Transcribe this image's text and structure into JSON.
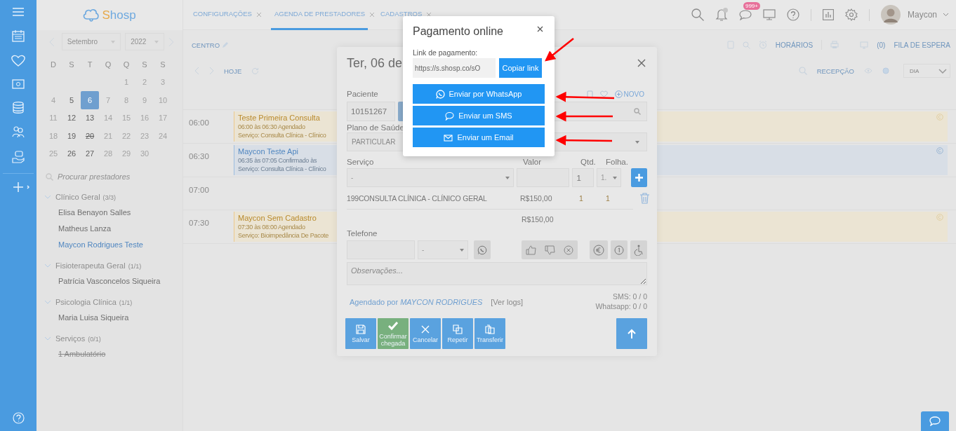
{
  "logo": {
    "text": "Shosp"
  },
  "date_picker": {
    "month": "Setembro",
    "year": "2022",
    "weekdays": [
      "D",
      "S",
      "T",
      "Q",
      "Q",
      "S",
      "S"
    ],
    "days": [
      {
        "label": "1",
        "available": false,
        "selected": false,
        "struck": false
      },
      {
        "label": "2",
        "available": false,
        "selected": false,
        "struck": false
      },
      {
        "label": "3",
        "available": false,
        "selected": false,
        "struck": false
      },
      {
        "label": "4",
        "available": false,
        "selected": false,
        "struck": false
      },
      {
        "label": "5",
        "available": true,
        "selected": false,
        "struck": false
      },
      {
        "label": "6",
        "available": true,
        "selected": true,
        "struck": false
      },
      {
        "label": "7",
        "available": false,
        "selected": false,
        "struck": false
      },
      {
        "label": "8",
        "available": false,
        "selected": false,
        "struck": false
      },
      {
        "label": "9",
        "available": false,
        "selected": false,
        "struck": false
      },
      {
        "label": "10",
        "available": false,
        "selected": false,
        "struck": false
      },
      {
        "label": "11",
        "available": false,
        "selected": false,
        "struck": false
      },
      {
        "label": "12",
        "available": true,
        "selected": false,
        "struck": false
      },
      {
        "label": "13",
        "available": true,
        "selected": false,
        "struck": false
      },
      {
        "label": "14",
        "available": false,
        "selected": false,
        "struck": false
      },
      {
        "label": "15",
        "available": false,
        "selected": false,
        "struck": false
      },
      {
        "label": "16",
        "available": false,
        "selected": false,
        "struck": false
      },
      {
        "label": "17",
        "available": false,
        "selected": false,
        "struck": false
      },
      {
        "label": "18",
        "available": false,
        "selected": false,
        "struck": false
      },
      {
        "label": "19",
        "available": true,
        "selected": false,
        "struck": false
      },
      {
        "label": "20",
        "available": true,
        "selected": false,
        "struck": true
      },
      {
        "label": "21",
        "available": false,
        "selected": false,
        "struck": false
      },
      {
        "label": "22",
        "available": false,
        "selected": false,
        "struck": false
      },
      {
        "label": "23",
        "available": false,
        "selected": false,
        "struck": false
      },
      {
        "label": "24",
        "available": false,
        "selected": false,
        "struck": false
      },
      {
        "label": "25",
        "available": false,
        "selected": false,
        "struck": false
      },
      {
        "label": "26",
        "available": true,
        "selected": false,
        "struck": false
      },
      {
        "label": "27",
        "available": true,
        "selected": false,
        "struck": false
      },
      {
        "label": "28",
        "available": false,
        "selected": false,
        "struck": false
      },
      {
        "label": "29",
        "available": false,
        "selected": false,
        "struck": false
      },
      {
        "label": "30",
        "available": false,
        "selected": false,
        "struck": false
      }
    ]
  },
  "provider_search": {
    "placeholder": "Procurar prestadores"
  },
  "provider_groups": [
    {
      "name": "Clínico Geral",
      "count": "(3/3)",
      "expanded": true,
      "children": [
        {
          "name": "Elisa Benayon Salles",
          "selected": false,
          "inactive": false
        },
        {
          "name": "Matheus Lanza",
          "selected": false,
          "inactive": false
        },
        {
          "name": "Maycon Rodrigues Teste",
          "selected": true,
          "inactive": false
        }
      ]
    },
    {
      "name": "Fisioterapeuta Geral",
      "count": "(1/1)",
      "expanded": true,
      "children": [
        {
          "name": "Patrícia Vasconcelos Siqueira",
          "selected": false,
          "inactive": false
        }
      ]
    },
    {
      "name": "Psicologia Clínica",
      "count": "(1/1)",
      "expanded": true,
      "children": [
        {
          "name": "Maria Luisa Siqueira",
          "selected": false,
          "inactive": false
        }
      ]
    },
    {
      "name": "Serviços",
      "count": "(0/1)",
      "expanded": true,
      "children": [
        {
          "name": "1 Ambulatório",
          "selected": false,
          "inactive": true
        }
      ]
    }
  ],
  "tabs": [
    {
      "label": "CONFIGURAÇÕES",
      "selected": false
    },
    {
      "label": "AGENDA DE PRESTADORES",
      "selected": true
    },
    {
      "label": "CADASTROS",
      "selected": false
    }
  ],
  "header": {
    "messages_badge": "999+",
    "user_name": "Maycon"
  },
  "toolbar": {
    "location": "CENTRO",
    "schedule_label": "HORÁRIOS",
    "queue_count": "(0)",
    "queue_label": "FILA DE ESPERA",
    "today": "HOJE",
    "reception": "RECEPÇÃO",
    "view": "DIA"
  },
  "schedule": [
    {
      "time": "06:00",
      "events": [
        {
          "kind": "scheduled",
          "title": "Teste Primeira Consulta",
          "detail": "06:00 às 06:30 Agendado",
          "service": "Serviço: Consulta Clínica - Clínico"
        }
      ]
    },
    {
      "time": "06:30",
      "events": [
        {
          "kind": "confirmed",
          "title": "Maycon Teste Api",
          "detail": "06:35 às 07:05 Confirmado às",
          "service": "Serviço: Consulta Clínica - Clínico"
        }
      ]
    },
    {
      "time": "07:00"
    },
    {
      "time": "07:30",
      "events": [
        {
          "kind": "scheduled",
          "title": "Maycon Sem Cadastro",
          "detail": "07:30 às 08:00 Agendado",
          "service": "Serviço: Bioimpedância De Pacote"
        }
      ]
    }
  ],
  "appointment": {
    "title": "Ter, 06 de",
    "patient_label": "Paciente",
    "new_label": "NOVO",
    "patient_id": "10151267",
    "plan_label": "Plano de Saúde",
    "plan": "PARTICULAR",
    "service_label": "Serviço",
    "value_label": "Valor",
    "qty_label": "Qtd.",
    "sheet_label": "Folha.",
    "service_select": "-",
    "qty": "1",
    "sheet": "1.",
    "items": [
      {
        "code": "199",
        "name": "CONSULTA CLÍNICA - CLÍNICO GERAL",
        "value": "R$150,00",
        "qty": "1",
        "sheet": "1"
      }
    ],
    "total": "R$150,00",
    "phone_label": "Telefone",
    "phone_type": "-",
    "notes_placeholder": "Observações...",
    "scheduled_by": "Agendado por *MAYCON RODRIGUES*",
    "logs_link": "[Ver logs]",
    "sms_count": "SMS: 0 / 0",
    "whatsapp_count": "Whatsapp: 0 / 0",
    "actions": [
      {
        "kind": "save",
        "label": "Salvar"
      },
      {
        "kind": "confirm",
        "label": "Confirmar chegada"
      },
      {
        "kind": "cancel",
        "label": "Cancelar"
      },
      {
        "kind": "repeat",
        "label": "Repetir"
      },
      {
        "kind": "transfer",
        "label": "Transferir"
      }
    ]
  },
  "payment_popup": {
    "title": "Pagamento online",
    "link_label": "Link de pagamento:",
    "link": "https://s.shosp.co/sO",
    "copy_label": "Copiar link",
    "send_buttons": [
      {
        "kind": "whatsapp",
        "label": "Enviar por WhatsApp"
      },
      {
        "kind": "sms",
        "label": "Enviar um SMS"
      },
      {
        "kind": "email",
        "label": "Enviar um Email"
      }
    ]
  }
}
